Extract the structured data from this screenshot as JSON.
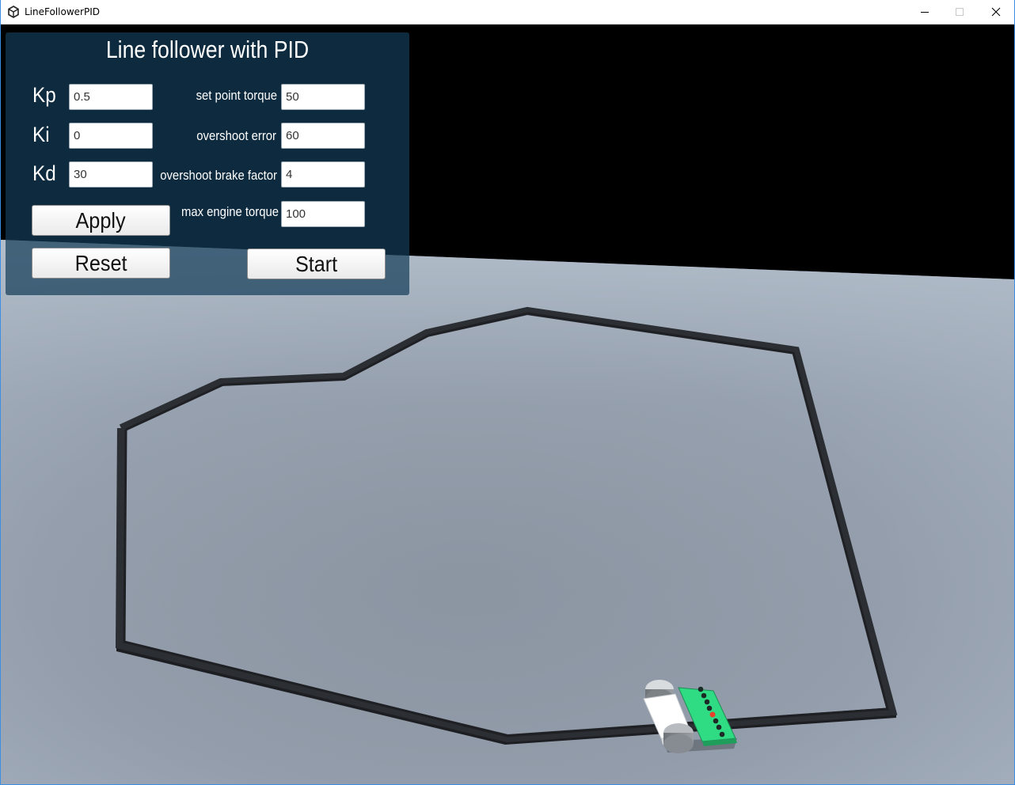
{
  "window": {
    "title": "LineFollowerPID",
    "controls": {
      "minimize": "minimize-icon",
      "maximize": "maximize-icon",
      "close": "close-icon"
    }
  },
  "panel": {
    "title": "Line follower with PID",
    "left_params": [
      {
        "label": "Kp",
        "value": "0.5"
      },
      {
        "label": "Ki",
        "value": "0"
      },
      {
        "label": "Kd",
        "value": "30"
      }
    ],
    "right_params": [
      {
        "label": "set point torque",
        "value": "50"
      },
      {
        "label": "overshoot error",
        "value": "60"
      },
      {
        "label": "overshoot brake factor",
        "value": "4"
      },
      {
        "label": "max engine torque",
        "value": "100"
      }
    ],
    "buttons": {
      "apply": "Apply",
      "reset": "Reset",
      "start": "Start"
    }
  },
  "colors": {
    "panel_bg": "#123c58",
    "sky": "#000000",
    "ground_top": "#a9b6c5",
    "ground_bottom": "#8a939f",
    "track": "#2b2e33",
    "sensor_board": "#2fdc84",
    "active_sensor": "#e8402a"
  }
}
